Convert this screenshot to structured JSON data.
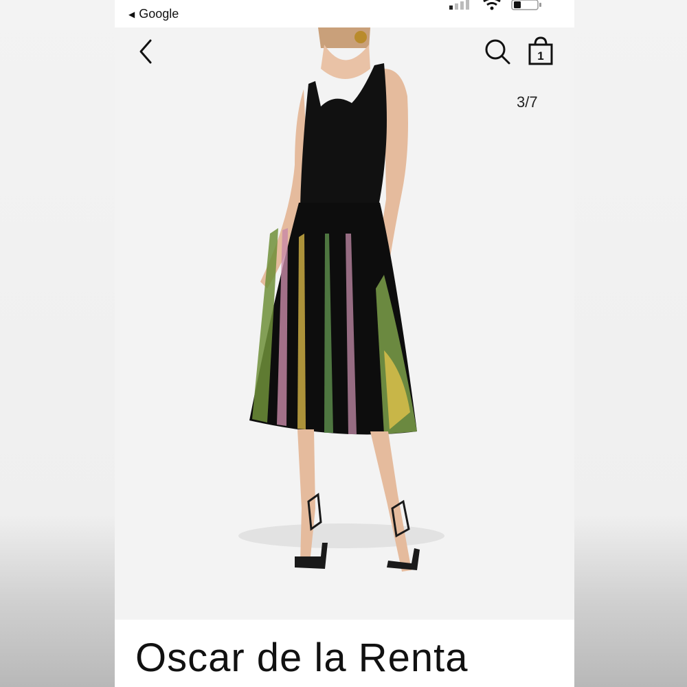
{
  "status_bar": {
    "back_app_label": "Google",
    "icons": [
      "signal-icon",
      "wifi-icon",
      "battery-icon"
    ]
  },
  "nav": {
    "back_icon": "chevron-left-icon",
    "search_icon": "search-icon",
    "bag_icon": "shopping-bag-icon",
    "bag_count": "1"
  },
  "gallery": {
    "counter": "3/7"
  },
  "product": {
    "brand": "Oscar de la Renta"
  }
}
